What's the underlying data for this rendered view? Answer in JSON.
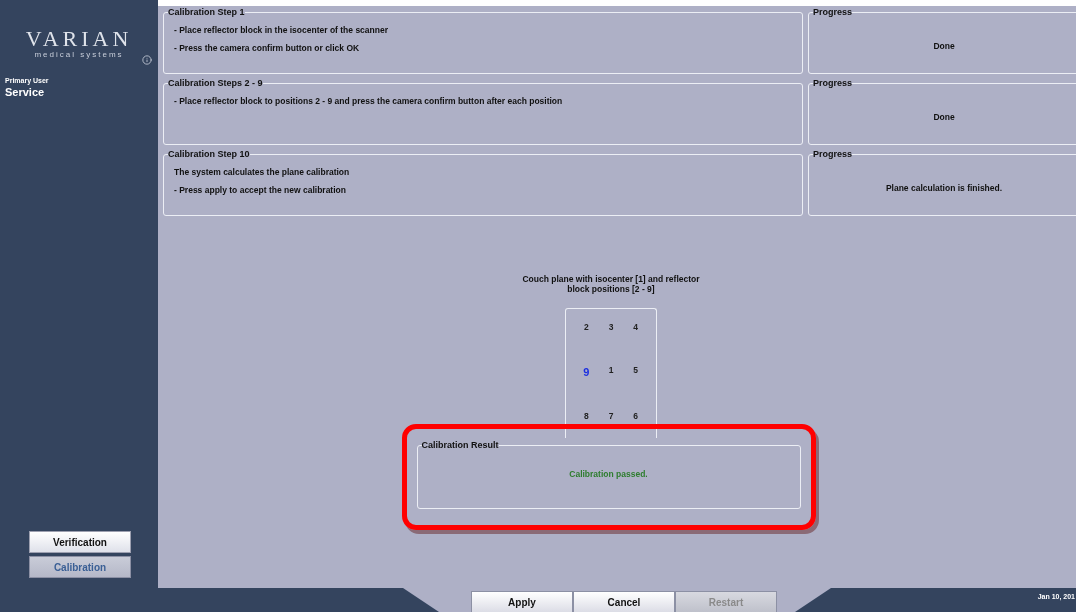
{
  "sidebar": {
    "logo": {
      "name": "VARIAN",
      "tagline": "medical systems"
    },
    "user_label": "Primary User",
    "user_name": "Service",
    "nav": [
      {
        "label": "Verification",
        "selected": false
      },
      {
        "label": "Calibration",
        "selected": true
      }
    ]
  },
  "steps": [
    {
      "title": "Calibration Step 1",
      "lines": [
        "- Place reflector block in the isocenter of the scanner",
        "- Press the camera confirm button or click OK"
      ],
      "progress_title": "Progress",
      "progress": "Done"
    },
    {
      "title": "Calibration Steps 2 - 9",
      "lines": [
        "- Place reflector block to positions 2 - 9 and press the camera confirm button after each position"
      ],
      "progress_title": "Progress",
      "progress": "Done"
    },
    {
      "title": "Calibration Step 10",
      "lines": [
        "The system calculates the plane calibration",
        "- Press apply to accept the new calibration"
      ],
      "progress_title": "Progress",
      "progress": "Plane calculation is finished."
    }
  ],
  "diagram": {
    "caption": "Couch plane with isocenter [1] and reflector block positions [2 - 9]",
    "positions": [
      {
        "label": "2",
        "current": false
      },
      {
        "label": "3",
        "current": false
      },
      {
        "label": "4",
        "current": false
      },
      {
        "label": "9",
        "current": true
      },
      {
        "label": "1",
        "current": false
      },
      {
        "label": "5",
        "current": false
      },
      {
        "label": "8",
        "current": false
      },
      {
        "label": "7",
        "current": false
      },
      {
        "label": "6",
        "current": false
      }
    ]
  },
  "result": {
    "title": "Calibration Result",
    "message": "Calibration passed.",
    "highlighted": true
  },
  "buttons": [
    {
      "label": "Apply",
      "disabled": false
    },
    {
      "label": "Cancel",
      "disabled": false
    },
    {
      "label": "Restart",
      "disabled": true
    }
  ],
  "status": {
    "date": "Jan 10, 201"
  }
}
